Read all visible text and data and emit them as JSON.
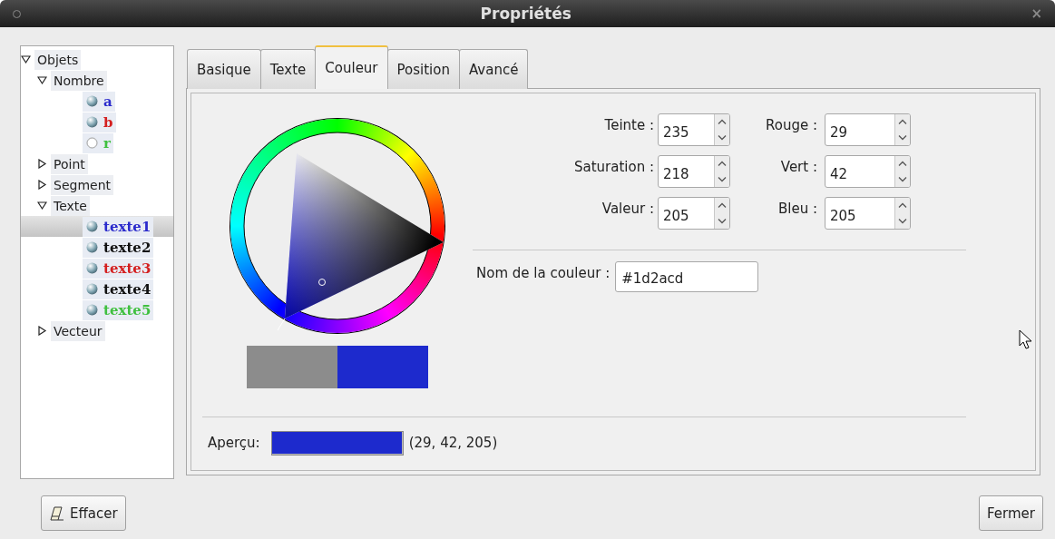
{
  "window": {
    "title": "Propriétés",
    "close": "×"
  },
  "tree": [
    {
      "label": "Objets",
      "expanded": true,
      "children": [
        {
          "label": "Nombre",
          "expanded": true,
          "children": [
            {
              "label": "a",
              "color": "#2b2bcc",
              "filled": true,
              "selected": false
            },
            {
              "label": "b",
              "color": "#d42020",
              "filled": true,
              "selected": false
            },
            {
              "label": "r",
              "color": "#40c040",
              "filled": false,
              "selected": false
            }
          ]
        },
        {
          "label": "Point",
          "expanded": false
        },
        {
          "label": "Segment",
          "expanded": false
        },
        {
          "label": "Texte",
          "expanded": true,
          "children": [
            {
              "label": "texte1",
              "color": "#2b2bcc",
              "filled": true,
              "selected": true
            },
            {
              "label": "texte2",
              "color": "#111111",
              "filled": true,
              "selected": false
            },
            {
              "label": "texte3",
              "color": "#d42020",
              "filled": true,
              "selected": false
            },
            {
              "label": "texte4",
              "color": "#111111",
              "filled": true,
              "selected": false
            },
            {
              "label": "texte5",
              "color": "#40c040",
              "filled": true,
              "selected": false
            }
          ]
        },
        {
          "label": "Vecteur",
          "expanded": false
        }
      ]
    }
  ],
  "tabs": [
    {
      "label": "Basique",
      "selected": false
    },
    {
      "label": "Texte",
      "selected": false
    },
    {
      "label": "Couleur",
      "selected": true
    },
    {
      "label": "Position",
      "selected": false
    },
    {
      "label": "Avancé",
      "selected": false
    }
  ],
  "color_picker": {
    "swatches": [
      {
        "color": "#8c8c8c"
      },
      {
        "color": "#1d2acd"
      }
    ],
    "fields": [
      {
        "label": "Teinte :",
        "value": "235"
      },
      {
        "label": "Rouge :",
        "value": "29"
      },
      {
        "label": "Saturation :",
        "value": "218"
      },
      {
        "label": "Vert :",
        "value": "42"
      },
      {
        "label": "Valeur :",
        "value": "205"
      },
      {
        "label": "Bleu :",
        "value": "205"
      }
    ],
    "name_field": {
      "label": "Nom de la couleur :",
      "value": "#1d2acd"
    }
  },
  "preview": {
    "label": "Aperçu:",
    "color": "#1d2acd",
    "reading": "(29, 42, 205)"
  },
  "buttons": {
    "clear": "Effacer",
    "close": "Fermer"
  }
}
